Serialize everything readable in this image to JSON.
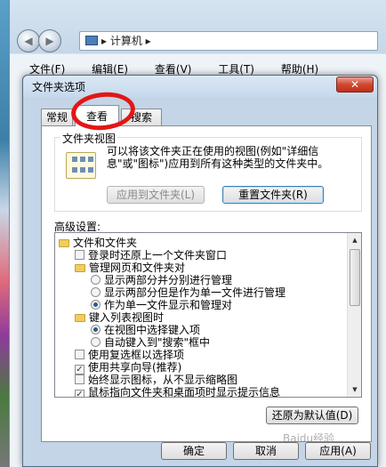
{
  "explorer": {
    "address_path": "▸ 计算机 ▸",
    "menu": [
      "文件(F)",
      "编辑(E)",
      "查看(V)",
      "工具(T)",
      "帮助(H)"
    ]
  },
  "dialog": {
    "title": "文件夹选项",
    "close_glyph": "✕",
    "tabs": [
      "常规",
      "查看",
      "搜索"
    ],
    "folder_views": {
      "group_label": "文件夹视图",
      "description": "可以将该文件夹正在使用的视图(例如\"详细信息\"或\"图标\")应用到所有这种类型的文件夹中。",
      "apply_button": "应用到文件夹(L)",
      "reset_button": "重置文件夹(R)"
    },
    "advanced_label": "高级设置:",
    "tree": [
      {
        "type": "folder",
        "label": "文件和文件夹"
      },
      {
        "type": "checkbox",
        "checked": false,
        "label": "登录时还原上一个文件夹窗口"
      },
      {
        "type": "folder",
        "label": "管理网页和文件夹对"
      },
      {
        "type": "radio",
        "checked": false,
        "label": "显示两部分并分别进行管理"
      },
      {
        "type": "radio",
        "checked": false,
        "label": "显示两部分但是作为单一文件进行管理"
      },
      {
        "type": "radio",
        "checked": true,
        "label": "作为单一文件显示和管理对"
      },
      {
        "type": "folder",
        "label": "键入列表视图时"
      },
      {
        "type": "radio",
        "checked": true,
        "label": "在视图中选择键入项"
      },
      {
        "type": "radio",
        "checked": false,
        "label": "自动键入到\"搜索\"框中"
      },
      {
        "type": "checkbox",
        "checked": false,
        "label": "使用复选框以选择项"
      },
      {
        "type": "checkbox",
        "checked": true,
        "label": "使用共享向导(推荐)"
      },
      {
        "type": "checkbox",
        "checked": false,
        "label": "始终显示图标，从不显示缩略图"
      },
      {
        "type": "checkbox",
        "checked": true,
        "label": "鼠标指向文件夹和桌面项时显示提示信息"
      }
    ],
    "restore_defaults": "还原为默认值(D)",
    "ok": "确定",
    "cancel": "取消",
    "apply": "应用(A)"
  },
  "watermark": "Baidu经验",
  "colors": {
    "annotation": "#e41616",
    "dialog_bg": "#c3d5e7"
  }
}
